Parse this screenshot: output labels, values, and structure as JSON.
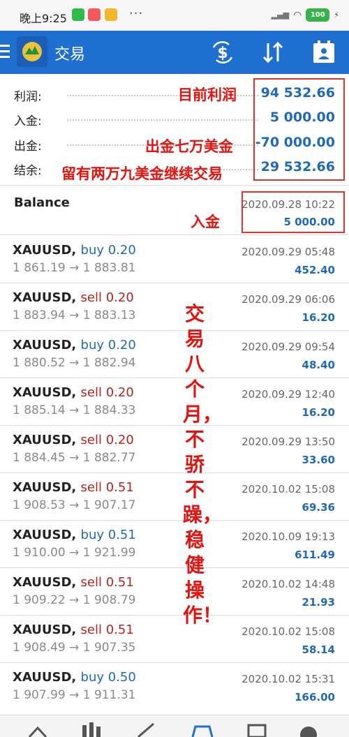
{
  "status": {
    "time": "晚上9:25",
    "battery": "100",
    "dots": "···"
  },
  "app": {
    "title": "交易"
  },
  "summary": [
    {
      "label": "利润:",
      "value": "94 532.66"
    },
    {
      "label": "入金:",
      "value": "5 000.00"
    },
    {
      "label": "出金:",
      "value": "-70 000.00"
    },
    {
      "label": "结余:",
      "value": "29 532.66"
    }
  ],
  "balance": {
    "label": "Balance",
    "date": "2020.09.28 10:22",
    "amount": "5 000.00"
  },
  "trades": [
    {
      "symbol": "XAUUSD,",
      "dir": "buy",
      "lot": "0.20",
      "prices": "1 861.19 → 1 883.81",
      "date": "2020.09.29 05:48",
      "profit": "452.40"
    },
    {
      "symbol": "XAUUSD,",
      "dir": "sell",
      "lot": "0.20",
      "prices": "1 883.94 → 1 883.13",
      "date": "2020.09.29 06:06",
      "profit": "16.20"
    },
    {
      "symbol": "XAUUSD,",
      "dir": "buy",
      "lot": "0.20",
      "prices": "1 880.52 → 1 882.94",
      "date": "2020.09.29 09:54",
      "profit": "48.40"
    },
    {
      "symbol": "XAUUSD,",
      "dir": "sell",
      "lot": "0.20",
      "prices": "1 885.14 → 1 884.33",
      "date": "2020.09.29 12:40",
      "profit": "16.20"
    },
    {
      "symbol": "XAUUSD,",
      "dir": "sell",
      "lot": "0.20",
      "prices": "1 884.45 → 1 882.77",
      "date": "2020.09.29 13:50",
      "profit": "33.60"
    },
    {
      "symbol": "XAUUSD,",
      "dir": "sell",
      "lot": "0.51",
      "prices": "1 908.53 → 1 907.17",
      "date": "2020.10.02 15:08",
      "profit": "69.36"
    },
    {
      "symbol": "XAUUSD,",
      "dir": "buy",
      "lot": "0.51",
      "prices": "1 910.00 → 1 921.99",
      "date": "2020.10.09 19:13",
      "profit": "611.49"
    },
    {
      "symbol": "XAUUSD,",
      "dir": "sell",
      "lot": "0.51",
      "prices": "1 909.22 → 1 908.79",
      "date": "2020.10.02 14:48",
      "profit": "21.93"
    },
    {
      "symbol": "XAUUSD,",
      "dir": "sell",
      "lot": "0.51",
      "prices": "1 908.49 → 1 907.35",
      "date": "2020.10.02 15:08",
      "profit": "58.14"
    },
    {
      "symbol": "XAUUSD,",
      "dir": "buy",
      "lot": "0.50",
      "prices": "1 907.99 → 1 911.31",
      "date": "2020.10.02 15:31",
      "profit": "166.00"
    }
  ],
  "annotations": {
    "profit_note": "目前利润",
    "withdraw_note": "出金七万美金",
    "remain_note": "留有两万九美金继续交易",
    "deposit_note": "入金",
    "vertical_note": "交易八个月，不骄不躁，稳健操作！"
  },
  "colors": {
    "appbar": "#1f6fd1",
    "accent": "#1f6ab5",
    "sell": "#b3261e",
    "annotation": "#e3140f"
  }
}
